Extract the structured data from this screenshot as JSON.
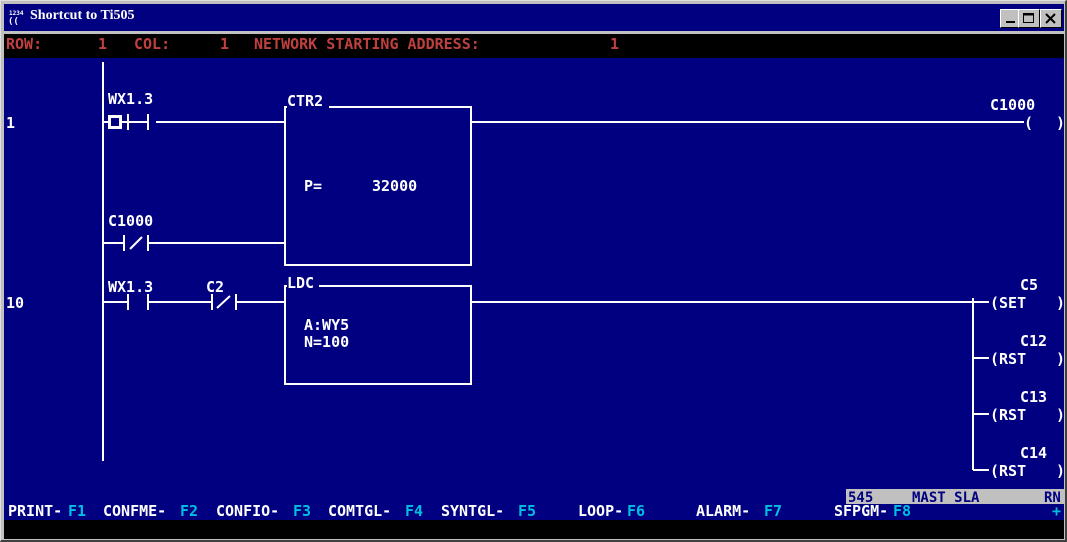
{
  "window": {
    "title": "Shortcut to Ti505",
    "icon_text": "(( )",
    "buttons": [
      "minimize",
      "maximize",
      "close"
    ]
  },
  "status": {
    "row_label": "ROW:",
    "row_value": "1",
    "col_label": "COL:",
    "col_value": "1",
    "network_label": "NETWORK STARTING ADDRESS:",
    "network_value": "1"
  },
  "networks": [
    {
      "number": "1",
      "contact1_label": "WX1.3",
      "contact2_label": "C1000",
      "box_name": "CTR2",
      "box_line1": "P=",
      "box_line1_value": "32000",
      "coil_label": "C1000",
      "coil_text": "(",
      "coil_close": ")"
    },
    {
      "number": "10",
      "contact1_label": "WX1.3",
      "contact2_label": "C2",
      "box_name": "LDC",
      "box_line1": "A:WY5",
      "box_line2": "N=100",
      "coils": [
        {
          "label": "C5",
          "text": "(SET",
          "close": ")"
        },
        {
          "label": "C12",
          "text": "(RST",
          "close": ")"
        },
        {
          "label": "C13",
          "text": "(RST",
          "close": ")"
        },
        {
          "label": "C14",
          "text": "(RST",
          "close": ")"
        }
      ]
    }
  ],
  "info_strip": {
    "model": "545",
    "mode": "MAST_SLA",
    "state": "RN"
  },
  "function_keys": [
    {
      "label": "PRINT-",
      "key": "F1"
    },
    {
      "label": "CONFME-",
      "key": "F2"
    },
    {
      "label": "CONFIO-",
      "key": "F3"
    },
    {
      "label": "COMTGL-",
      "key": "F4"
    },
    {
      "label": "SYNTGL-",
      "key": "F5"
    },
    {
      "label": "LOOP-",
      "key": "F6"
    },
    {
      "label": "ALARM-",
      "key": "F7"
    },
    {
      "label": "SFPGM-",
      "key": "F8"
    },
    {
      "label": "",
      "key": "+"
    }
  ],
  "colors": {
    "screen_bg": "#000080",
    "text": "#ffffff",
    "status_text": "#c04040",
    "function_key": "#00c0e0",
    "strip_bg": "#c0c0c0",
    "strip_text": "#000080"
  }
}
